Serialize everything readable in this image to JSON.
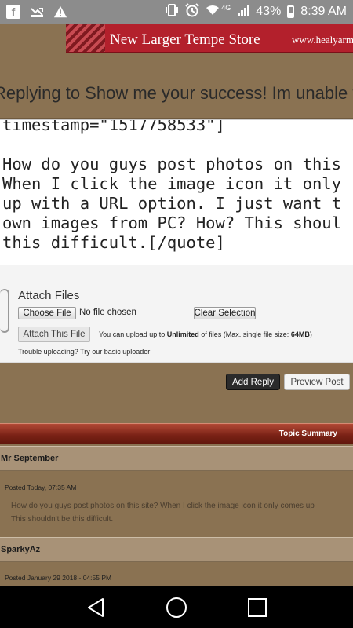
{
  "status_bar": {
    "left_icons": [
      "facebook-icon",
      "missed-call-icon",
      "warning-icon"
    ],
    "network": "4G",
    "battery": "43%",
    "time": "8:39 AM"
  },
  "banner": {
    "title": "New Larger Tempe Store",
    "url": "www.healyarm"
  },
  "reply_heading": "Replying to Show me your success! Im unable t",
  "editor": {
    "text": "timestamp=\"1517758533\"]\n\nHow do you guys post photos on this\nWhen I click the image icon it only\nup with a URL option. I just want t\nown images from PC? How? This shoul\nthis difficult.[/quote]"
  },
  "attach": {
    "title": "Attach Files",
    "choose_label": "Choose File",
    "no_file": "No file chosen",
    "clear_label": "Clear Selection",
    "attach_label": "Attach This File",
    "limit_prefix": "You can upload up to ",
    "limit_strong": "Unlimited",
    "limit_middle": " of files (Max. single file size: ",
    "limit_size": "64MB",
    "limit_suffix": ")",
    "trouble": "Trouble uploading? Try our basic uploader"
  },
  "actions": {
    "add_reply": "Add Reply",
    "preview": "Preview Post"
  },
  "summary": {
    "title": "Topic Summary",
    "posts": [
      {
        "author": "Mr September",
        "posted": "Posted Today, 07:35 AM",
        "excerpt_line1": "How do you guys post photos on this site? When I click the image icon it only comes up",
        "excerpt_line2": "This shouldn't be this difficult."
      },
      {
        "author": "SparkyAz",
        "posted": "Posted January 29 2018 - 04:55 PM"
      }
    ]
  },
  "navbar": {
    "buttons": [
      "back-icon",
      "home-icon",
      "recents-icon"
    ]
  }
}
